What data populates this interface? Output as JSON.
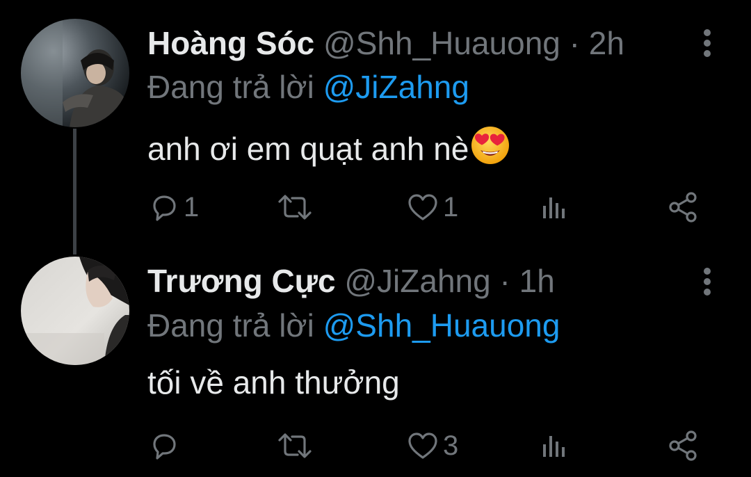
{
  "tweets": [
    {
      "display_name": "Hoàng Sóc",
      "handle": "@Shh_Huauong",
      "separator": "·",
      "time": "2h",
      "reply_prefix": "Đang trả lời",
      "reply_to": "@JiZahng",
      "text": "anh ơi em quạt anh nè",
      "emoji": "smiling-face-with-heart-eyes",
      "replies": "1",
      "retweets": "",
      "likes": "1"
    },
    {
      "display_name": "Trương Cực",
      "handle": "@JiZahng",
      "separator": "·",
      "time": "1h",
      "reply_prefix": "Đang trả lời",
      "reply_to": "@Shh_Huauong",
      "text": "tối về anh thưởng",
      "replies": "",
      "retweets": "",
      "likes": "3"
    }
  ],
  "icons": {
    "reply": "reply-icon",
    "retweet": "retweet-icon",
    "like": "heart-icon",
    "views": "views-icon",
    "share": "share-icon",
    "more": "more-icon"
  },
  "colors": {
    "background": "#000000",
    "text": "#e7e9ea",
    "secondary": "#71767b",
    "mention": "#1d9bf0",
    "thread_line": "#3d4146"
  }
}
